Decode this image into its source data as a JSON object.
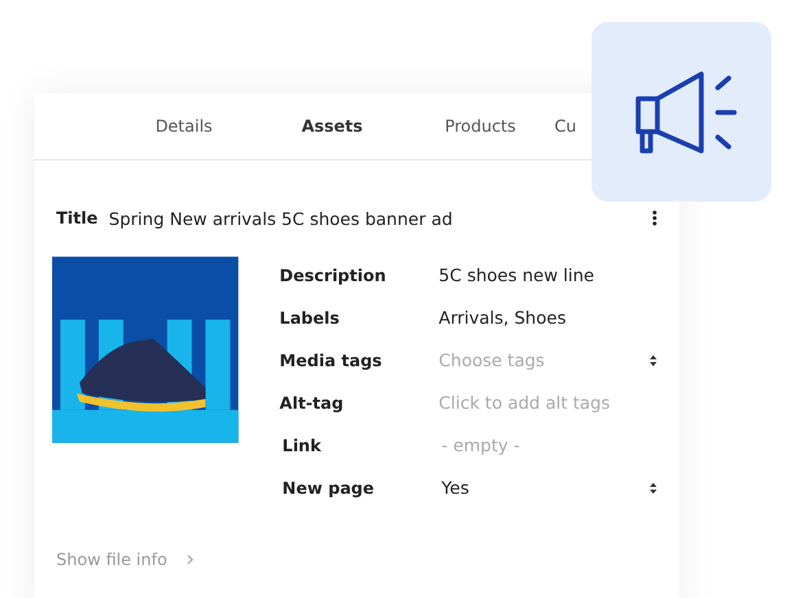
{
  "tabs": [
    {
      "label": "Details",
      "selected": false
    },
    {
      "label": "Assets",
      "selected": true
    },
    {
      "label": "Products",
      "selected": false
    },
    {
      "label": "Cu",
      "selected": false
    }
  ],
  "asset": {
    "title_label": "Title",
    "title": "Spring New arrivals 5C shoes banner ad",
    "fields": [
      {
        "kind": "text",
        "label": "Description",
        "value": "5C shoes new line"
      },
      {
        "kind": "text",
        "label": "Labels",
        "value": "Arrivals, Shoes"
      },
      {
        "kind": "select",
        "label": "Media tags",
        "placeholder": "Choose tags"
      },
      {
        "kind": "text",
        "label": "Alt-tag",
        "placeholder": "Click to add alt tags"
      },
      {
        "kind": "text",
        "label": "Link",
        "placeholder": "- empty -"
      },
      {
        "kind": "select",
        "label": "New page",
        "value": "Yes"
      }
    ],
    "show_file_info": "Show file info"
  }
}
